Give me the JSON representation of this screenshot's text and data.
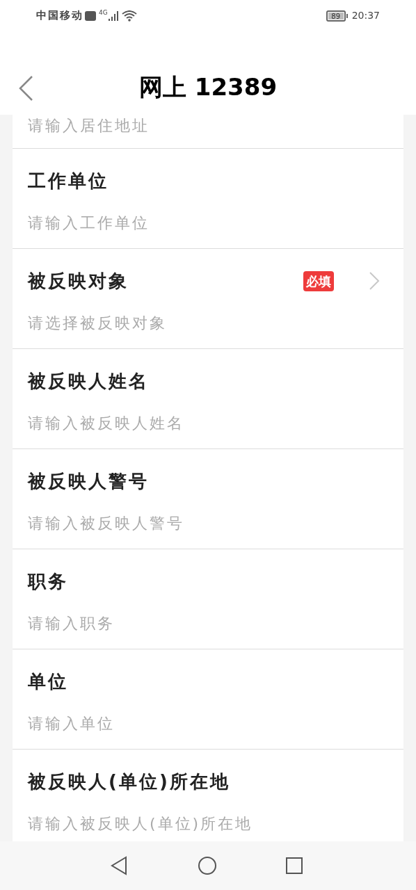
{
  "status_bar": {
    "carrier": "中国移动",
    "network": "4G",
    "battery": "89",
    "time": "20:37"
  },
  "header": {
    "title": "网上 12389"
  },
  "partial_field": {
    "placeholder": "请输入居住地址"
  },
  "fields": [
    {
      "label": "工作单位",
      "placeholder": "请输入工作单位",
      "required": false,
      "kind": "input"
    },
    {
      "label": "被反映对象",
      "placeholder": "请选择被反映对象",
      "required": true,
      "badge": "必填",
      "kind": "select"
    },
    {
      "label": "被反映人姓名",
      "placeholder": "请输入被反映人姓名",
      "required": false,
      "kind": "input"
    },
    {
      "label": "被反映人警号",
      "placeholder": "请输入被反映人警号",
      "required": false,
      "kind": "input"
    },
    {
      "label": "职务",
      "placeholder": "请输入职务",
      "required": false,
      "kind": "input"
    },
    {
      "label": "单位",
      "placeholder": "请输入单位",
      "required": false,
      "kind": "input"
    },
    {
      "label": "被反映人(单位)所在地",
      "placeholder": "请输入被反映人(单位)所在地",
      "required": false,
      "kind": "input"
    }
  ]
}
